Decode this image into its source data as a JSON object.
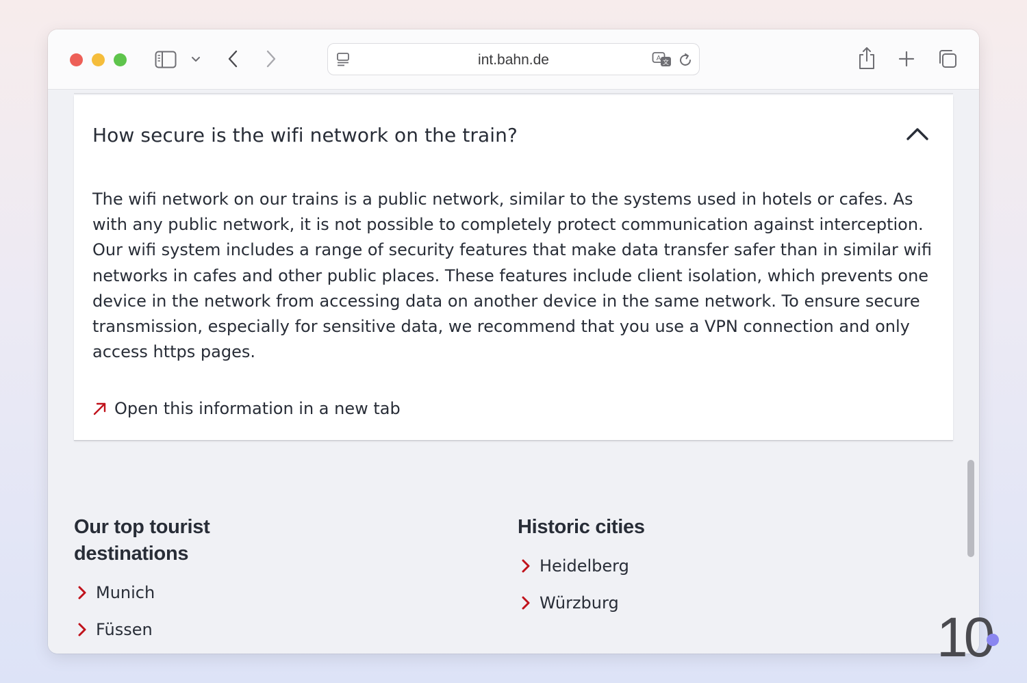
{
  "browser": {
    "url": "int.bahn.de",
    "icons": {
      "sidebar": "sidebar-icon",
      "back": "chevron-left-icon",
      "forward": "chevron-right-icon",
      "reader": "reader-icon",
      "translate": "translate-icon",
      "reload": "reload-icon",
      "share": "share-icon",
      "new_tab": "plus-icon",
      "tabs": "tab-overview-icon"
    }
  },
  "faq": {
    "question": "How secure is the wifi network on the train?",
    "answer": "The wifi network on our trains is a public network, similar to the systems used in hotels or cafes. As with any public network, it is not possible to completely protect communication against interception. Our wifi system includes a range of security features that make data transfer safer than in similar wifi networks in cafes and other public places. These features include client isolation, which prevents one device in the network from accessing data on another device in the same network. To ensure secure transmission, especially for sensitive data, we recommend that you use a VPN connection and only access https pages.",
    "link_label": "Open this information in a new tab"
  },
  "destinations": {
    "title": "Our top tourist destinations",
    "items": [
      "Munich",
      "Füssen"
    ]
  },
  "historic": {
    "title": "Historic cities",
    "items": [
      "Heidelberg",
      "Würzburg"
    ]
  },
  "overlay_badge": "10",
  "colors": {
    "accent_red": "#c0121b",
    "text": "#282d37",
    "badge_dot": "#8a86f0"
  }
}
